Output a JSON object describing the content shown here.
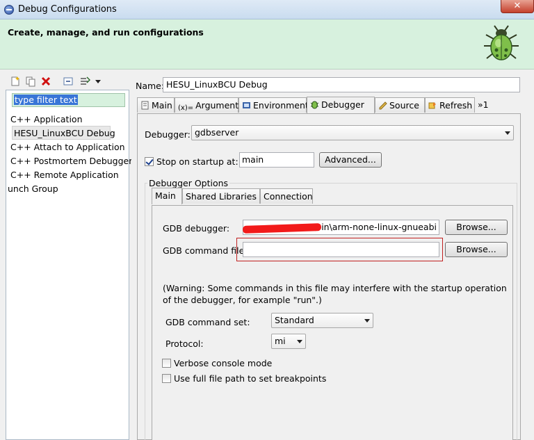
{
  "window": {
    "title": "Debug Configurations",
    "close_glyph": "✕"
  },
  "banner": {
    "heading": "Create, manage, and run configurations",
    "icon": "bug-icon"
  },
  "left": {
    "toolbar_icons": [
      "new-config-icon",
      "duplicate-icon",
      "delete-icon",
      "collapse-all-icon",
      "filter-icon",
      "view-menu-icon"
    ],
    "filter_text": "type filter text",
    "tree": [
      "C++ Application",
      "HESU_LinuxBCU Debug",
      "C++ Attach to Application",
      "C++ Postmortem Debugger",
      "C++ Remote Application",
      "unch Group"
    ]
  },
  "config": {
    "name_label": "Name:",
    "name_value": "HESU_LinuxBCU Debug",
    "tabs": [
      "Main",
      "Arguments",
      "Environment",
      "Debugger",
      "Source",
      "Refresh"
    ],
    "tab_overflow": "»1",
    "active_tab": "Debugger"
  },
  "debugger": {
    "label": "Debugger:",
    "selected": "gdbserver",
    "stop_label": "Stop on startup at:",
    "stop_value": "main",
    "stop_checked": true,
    "advanced_label": "Advanced...",
    "options_label": "Debugger Options",
    "inner_tabs": [
      "Main",
      "Shared Libraries",
      "Connection"
    ],
    "gdb_label": "GDB debugger:",
    "gdb_value": "\\bin\\arm-none-linux-gnueabi",
    "browse_label": "Browse...",
    "cmd_file_label": "GDB command file:",
    "cmd_file_value": "",
    "warning": "(Warning: Some commands in this file may interfere with the startup operation of the debugger, for example \"run\".)",
    "cmd_set_label": "GDB command set:",
    "cmd_set_value": "Standard",
    "protocol_label": "Protocol:",
    "protocol_value": "mi",
    "verbose_label": "Verbose console mode",
    "fullpath_label": "Use full file path to set breakpoints"
  }
}
